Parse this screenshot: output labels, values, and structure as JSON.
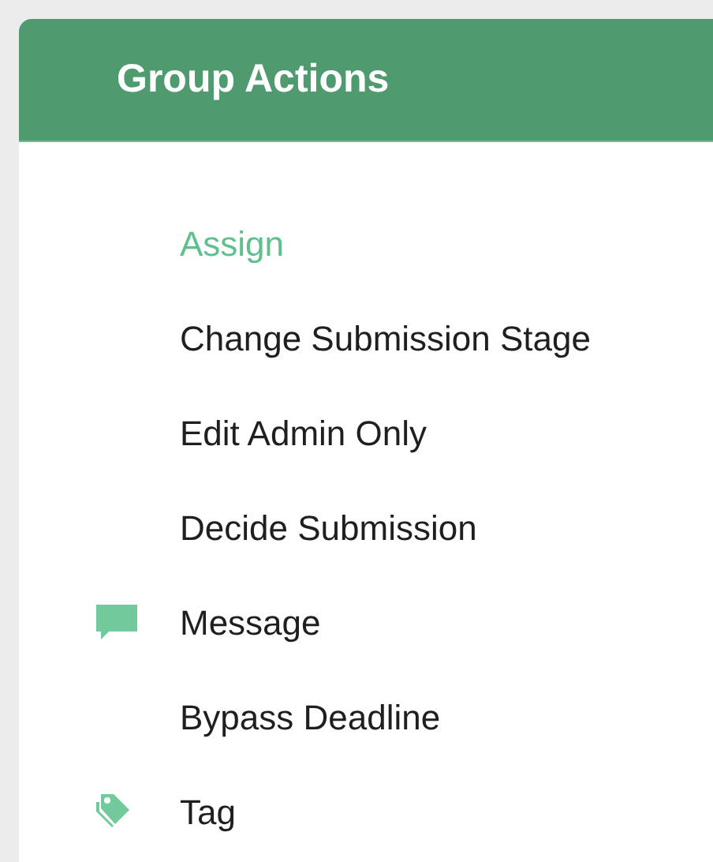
{
  "panel": {
    "title": "Group Actions"
  },
  "actions": [
    {
      "label": "Assign",
      "selected": true,
      "kind": "plain"
    },
    {
      "label": "Change Submission Stage",
      "selected": false,
      "kind": "plain"
    },
    {
      "label": "Edit Admin Only",
      "selected": false,
      "kind": "plain"
    },
    {
      "label": "Decide Submission",
      "selected": false,
      "kind": "plain"
    },
    {
      "label": "Message",
      "selected": false,
      "kind": "speech"
    },
    {
      "label": "Bypass Deadline",
      "selected": false,
      "kind": "plain"
    },
    {
      "label": "Tag",
      "selected": false,
      "kind": "tag"
    }
  ]
}
